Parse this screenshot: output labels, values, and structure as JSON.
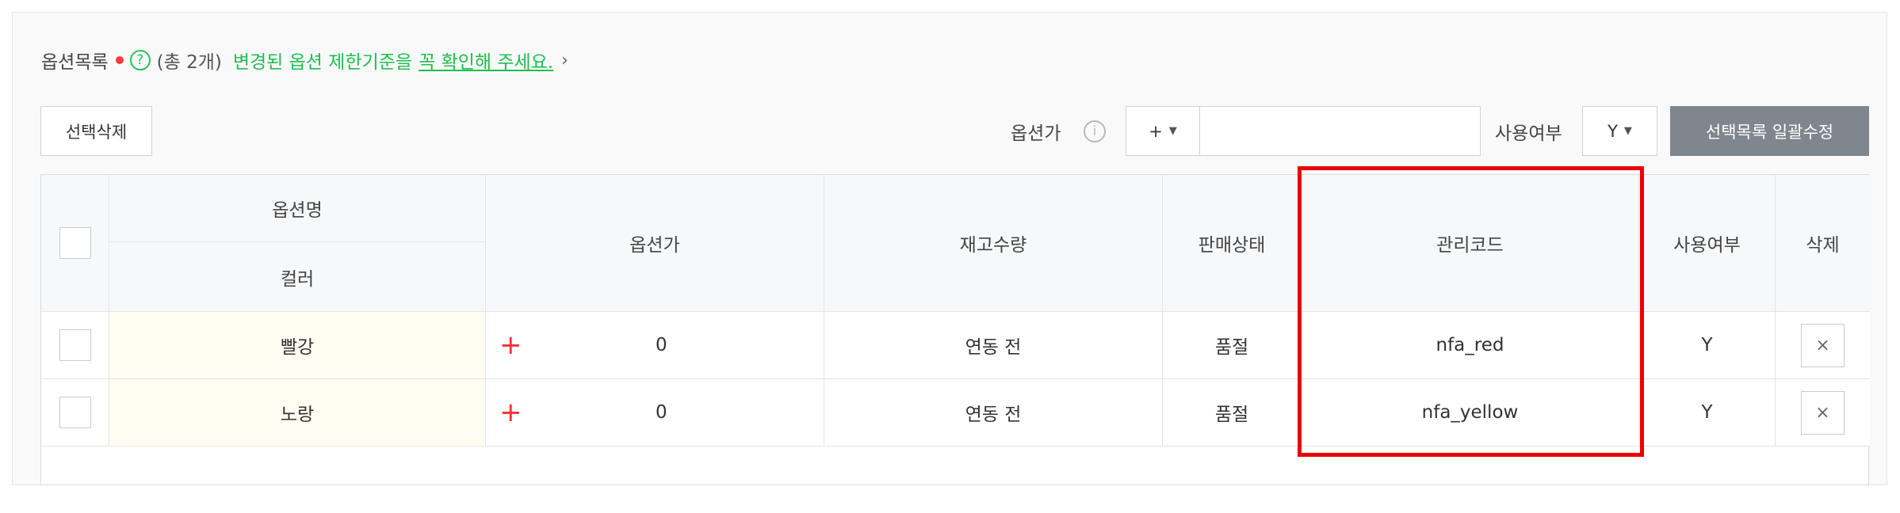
{
  "header": {
    "title": "옵션목록",
    "help_glyph": "?",
    "total": "(총 2개)",
    "notice": "변경된 옵션 제한기준을",
    "notice_link": "꼭 확인해 주세요.",
    "chevron": "›"
  },
  "toolbar": {
    "delete_selected": "선택삭제",
    "price_label": "옵션가",
    "info_glyph": "i",
    "sign_value": "+",
    "price_input_value": "",
    "use_label": "사용여부",
    "use_value": "Y",
    "bulk_edit": "선택목록 일괄수정"
  },
  "table": {
    "headers": {
      "option_name": "옵션명",
      "color": "컬러",
      "option_price": "옵션가",
      "stock": "재고수량",
      "sale_status": "판매상태",
      "manage_code": "관리코드",
      "use_yn": "사용여부",
      "delete": "삭제"
    },
    "rows": [
      {
        "name": "빨강",
        "sign": "+",
        "price": "0",
        "stock": "연동 전",
        "status": "품절",
        "code": "nfa_red",
        "use": "Y",
        "delete": "×"
      },
      {
        "name": "노랑",
        "sign": "+",
        "price": "0",
        "stock": "연동 전",
        "status": "품절",
        "code": "nfa_yellow",
        "use": "Y",
        "delete": "×"
      }
    ]
  },
  "colors": {
    "required_dot": "#ff3b3b",
    "notice_green": "#1ebf4d",
    "plus_red": "#ff3030",
    "highlight_red": "#ea0000",
    "bulk_button": "#7f868e"
  }
}
